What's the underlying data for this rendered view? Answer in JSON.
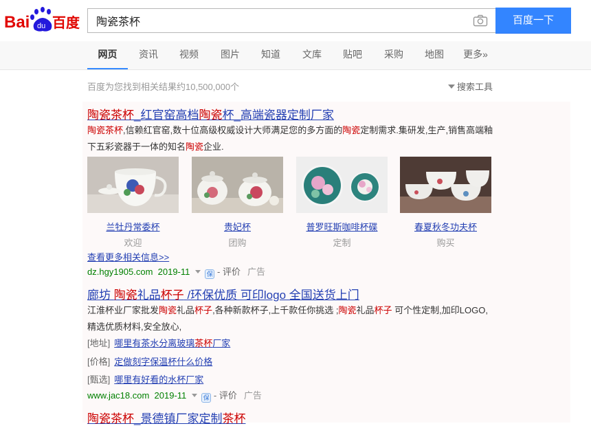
{
  "header": {
    "logo_text": "Bai度百度",
    "search_value": "陶瓷茶杯",
    "search_button": "百度一下"
  },
  "nav": {
    "tabs": [
      "网页",
      "资讯",
      "视频",
      "图片",
      "知道",
      "文库",
      "贴吧",
      "采购",
      "地图",
      "更多»"
    ],
    "active": "网页"
  },
  "result_stats": "百度为您找到相关结果约10,500,000个",
  "search_tools": "搜索工具",
  "results": [
    {
      "title_parts": [
        [
          "陶瓷茶杯",
          true
        ],
        [
          "_红官窑高档",
          false
        ],
        [
          "陶瓷",
          true
        ],
        [
          "杯",
          false
        ],
        [
          "_高端瓷器定制厂家",
          false
        ]
      ],
      "desc_parts": [
        [
          "陶瓷茶杯",
          true
        ],
        [
          ",信赖红官窑,数十位高级权威设计大师满足您的多方面的",
          false
        ],
        [
          "陶瓷",
          true
        ],
        [
          "定制需求.集研发,生产,销售高端釉下五彩瓷器于一体的知名",
          false
        ],
        [
          "陶瓷",
          true
        ],
        [
          "企业.",
          false
        ]
      ],
      "thumbs": [
        {
          "caption": "兰牡丹常委杯",
          "sub": "欢迎"
        },
        {
          "caption": "贵妃杯",
          "sub": "团购"
        },
        {
          "caption": "普罗旺斯咖啡杯碟",
          "sub": "定制"
        },
        {
          "caption": "春夏秋冬功夫杯",
          "sub": "购买"
        }
      ],
      "more": "查看更多相关信息>>",
      "url": "dz.hgy1905.com",
      "date": "2019-11",
      "eval": "- 评价",
      "ad": "广告"
    },
    {
      "title_parts": [
        [
          "廊坊 ",
          false
        ],
        [
          "陶瓷",
          true
        ],
        [
          "礼品",
          false
        ],
        [
          "杯子",
          true
        ],
        [
          " /环保优质 可印logo 全国送货上门",
          false
        ]
      ],
      "desc_parts": [
        [
          "江淮杯业厂家批发",
          false
        ],
        [
          "陶瓷",
          true
        ],
        [
          "礼品",
          false
        ],
        [
          "杯子",
          true
        ],
        [
          ",各种新款杯子,上千款任你挑选 ;",
          false
        ],
        [
          "陶瓷",
          true
        ],
        [
          "礼品",
          false
        ],
        [
          "杯子",
          true
        ],
        [
          " 可个性定制,加印LOGO,精选优质材料,安全放心,",
          false
        ]
      ],
      "subs": [
        {
          "tag": "[地址]",
          "link_parts": [
            [
              "哪里有茶水分离玻璃",
              false
            ],
            [
              "茶杯",
              true
            ],
            [
              "厂家",
              false
            ]
          ]
        },
        {
          "tag": "[价格]",
          "link_parts": [
            [
              "定做刻字保温杯什么价格",
              false
            ]
          ]
        },
        {
          "tag": "[甄选]",
          "link_parts": [
            [
              "哪里有好看的水杯厂家",
              false
            ]
          ]
        }
      ],
      "url": "www.jac18.com",
      "date": "2019-11",
      "eval": "- 评价",
      "ad": "广告"
    },
    {
      "title_parts": [
        [
          "陶瓷茶杯",
          true
        ],
        [
          "_景德镇厂家定制",
          false
        ],
        [
          "茶杯",
          true
        ]
      ]
    }
  ],
  "colors": {
    "link": "#2440b3",
    "highlight": "#c00000",
    "url": "#008000",
    "button": "#3385ff",
    "baidu_red": "#e10601",
    "baidu_blue": "#2319dc"
  }
}
